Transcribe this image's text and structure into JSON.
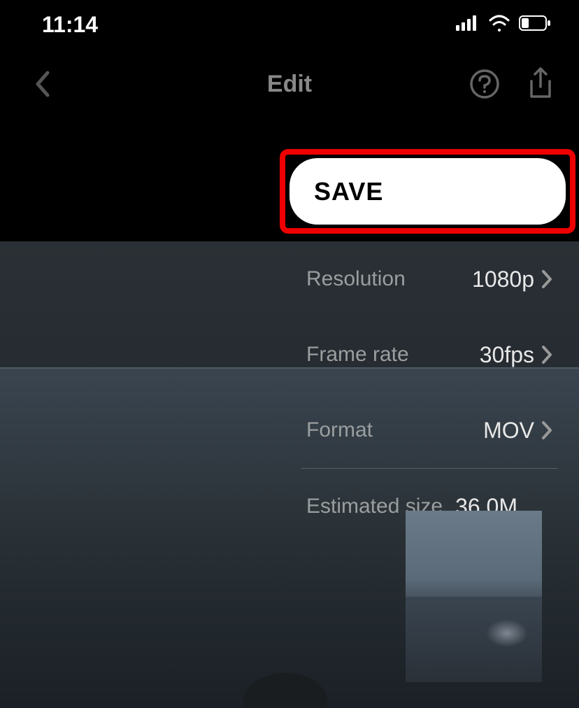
{
  "status": {
    "time": "11:14"
  },
  "nav": {
    "title": "Edit"
  },
  "save": {
    "label": "SAVE"
  },
  "settings": {
    "resolution": {
      "label": "Resolution",
      "value": "1080p"
    },
    "frameRate": {
      "label": "Frame rate",
      "value": "30fps"
    },
    "format": {
      "label": "Format",
      "value": "MOV"
    },
    "estimatedSize": {
      "label": "Estimated size",
      "value": "36.0M"
    }
  }
}
